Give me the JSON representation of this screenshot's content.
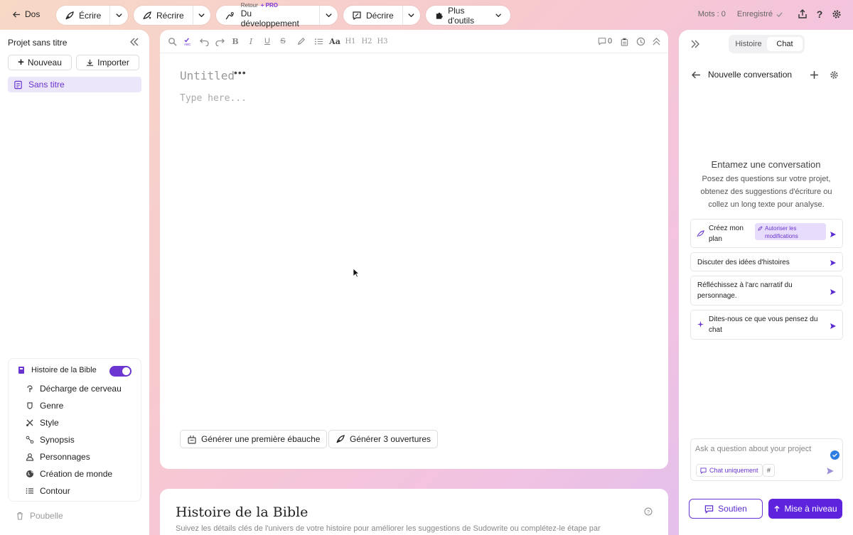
{
  "topbar": {
    "back_label": "Dos",
    "write_label": "Écrire",
    "rewrite_label": "Récrire",
    "retour_small": "Retour",
    "pro_label": "+ PRO",
    "retour_main": "Du développement",
    "describe_label": "Décrire",
    "more_tools_label": "Plus d'outils",
    "word_count": "Mots : 0",
    "saved_label": "Enregistré"
  },
  "sidebar": {
    "project_title": "Projet sans titre",
    "new_label": "Nouveau",
    "import_label": "Importer",
    "document_label": "Sans titre",
    "bible": {
      "title": "Histoire de la Bible",
      "toggle_on": true,
      "items": [
        {
          "label": "Décharge de cerveau",
          "icon": "brain-icon"
        },
        {
          "label": "Genre",
          "icon": "genre-icon"
        },
        {
          "label": "Style",
          "icon": "style-icon"
        },
        {
          "label": "Synopsis",
          "icon": "synopsis-icon"
        },
        {
          "label": "Personnages",
          "icon": "person-icon"
        },
        {
          "label": "Création de monde",
          "icon": "globe-icon"
        },
        {
          "label": "Contour",
          "icon": "list-icon"
        }
      ]
    },
    "trash_label": "Poubelle"
  },
  "editor": {
    "comment_count": "0",
    "title_placeholder": "Untitled",
    "body_placeholder": "Type here...",
    "generate_draft_label": "Générer une première ébauche",
    "generate_openings_label": "Générer 3 ouvertures"
  },
  "bible_panel": {
    "title": "Histoire de la Bible",
    "description": "Suivez les détails clés de l'univers de votre histoire pour améliorer les suggestions de Sudowrite ou complétez-le étape par"
  },
  "chat": {
    "tab_history": "Histoire",
    "tab_chat": "Chat",
    "conversation_title": "Nouvelle conversation",
    "empty_title": "Entamez une conversation",
    "empty_desc": "Posez des questions sur votre projet, obtenez des suggestions d'écriture ou collez un long texte pour analyse.",
    "suggestions": [
      {
        "label": "Créez mon plan",
        "badge": "Autoriser les modifications"
      },
      {
        "label": "Discuter des idées d'histoires"
      },
      {
        "label": "Réfléchissez à l'arc narratif du personnage."
      },
      {
        "label": "Dites-nous ce que vous pensez du chat"
      }
    ],
    "input_placeholder": "Ask a question about your project",
    "chat_only_label": "Chat uniquement",
    "hash_label": "#",
    "support_label": "Soutien",
    "upgrade_label": "Mise à niveau"
  },
  "colors": {
    "accent": "#6a35d0",
    "upgrade_bg": "#5e23dc"
  }
}
